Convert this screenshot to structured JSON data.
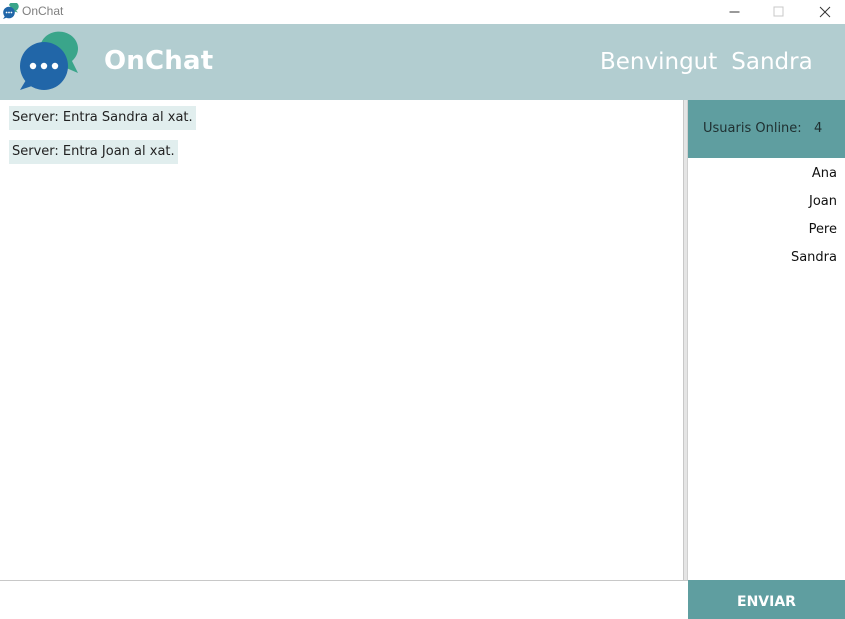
{
  "window": {
    "title": "OnChat",
    "icons": {
      "app": "chat-bubbles-icon",
      "minimize": "minimize-icon",
      "maximize": "maximize-icon",
      "close": "close-icon"
    }
  },
  "header": {
    "brand": "OnChat",
    "logo_icon": "chat-bubbles-logo-icon",
    "welcome_label": "Benvingut",
    "user_name": "Sandra",
    "background": "#b2cdd0"
  },
  "chat": {
    "messages": [
      {
        "text": "Server: Entra Sandra al xat."
      },
      {
        "text": "Server: Entra Joan al xat."
      }
    ],
    "message_background": "#e1eeee"
  },
  "users_panel": {
    "label": "Usuaris Online:",
    "count": "4",
    "users": [
      "Ana",
      "Joan",
      "Pere",
      "Sandra"
    ],
    "accent": "#5f9ea0"
  },
  "composer": {
    "input_value": "",
    "send_label": "ENVIAR"
  }
}
